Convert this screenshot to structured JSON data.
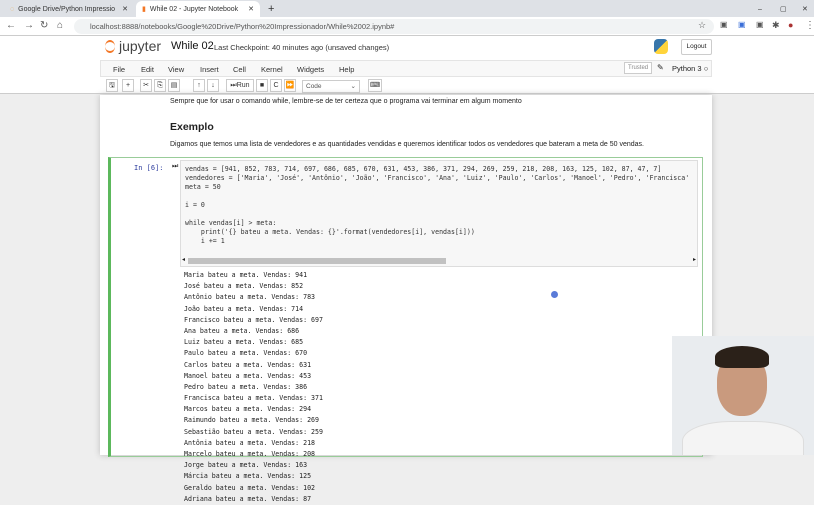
{
  "browser": {
    "tabs": [
      {
        "title": "Google Drive/Python Impressio"
      },
      {
        "title": "While 02 - Jupyter Notebook"
      }
    ],
    "url": "localhost:8888/notebooks/Google%20Drive/Python%20Impressionador/While%2002.ipynb#"
  },
  "jupyter": {
    "logo": "jupyter",
    "notebook_title": "While 02",
    "checkpoint": "Last Checkpoint: 40 minutes ago  (unsaved changes)",
    "logout": "Logout",
    "menu": [
      "File",
      "Edit",
      "View",
      "Insert",
      "Cell",
      "Kernel",
      "Widgets",
      "Help"
    ],
    "trusted": "Trusted",
    "kernel": "Python 3",
    "run_label": "Run",
    "cell_type": "Code"
  },
  "notebook": {
    "note": "Sempre que for usar o comando while, lembre-se de ter certeza que o programa vai terminar em algum momento",
    "heading": "Exemplo",
    "description": "Digamos que temos uma lista de vendedores e as quantidades vendidas e queremos identificar todos os vendedores que bateram a meta de 50 vendas.",
    "prompt": "In [6]:",
    "code": [
      "vendas = [941, 852, 783, 714, 697, 686, 685, 670, 631, 453, 386, 371, 294, 269, 259, 218, 208, 163, 125, 102, 87, 47, 7]",
      "vendedores = ['Maria', 'José', 'Antônio', 'João', 'Francisco', 'Ana', 'Luiz', 'Paulo', 'Carlos', 'Manoel', 'Pedro', 'Francisca'",
      "meta = 50",
      "",
      "i = 0",
      "",
      "while vendas[i] > meta:",
      "    print('{} bateu a meta. Vendas: {}'.format(vendedores[i], vendas[i]))",
      "    i += 1"
    ],
    "output": [
      "Maria bateu a meta. Vendas: 941",
      "José bateu a meta. Vendas: 852",
      "Antônio bateu a meta. Vendas: 783",
      "João bateu a meta. Vendas: 714",
      "Francisco bateu a meta. Vendas: 697",
      "Ana bateu a meta. Vendas: 686",
      "Luiz bateu a meta. Vendas: 685",
      "Paulo bateu a meta. Vendas: 670",
      "Carlos bateu a meta. Vendas: 631",
      "Manoel bateu a meta. Vendas: 453",
      "Pedro bateu a meta. Vendas: 386",
      "Francisca bateu a meta. Vendas: 371",
      "Marcos bateu a meta. Vendas: 294",
      "Raimundo bateu a meta. Vendas: 269",
      "Sebastião bateu a meta. Vendas: 259",
      "Antônia bateu a meta. Vendas: 218",
      "Marcelo bateu a meta. Vendas: 208",
      "Jorge bateu a meta. Vendas: 163",
      "Márcia bateu a meta. Vendas: 125",
      "Geraldo bateu a meta. Vendas: 102",
      "Adriana bateu a meta. Vendas: 87"
    ]
  }
}
